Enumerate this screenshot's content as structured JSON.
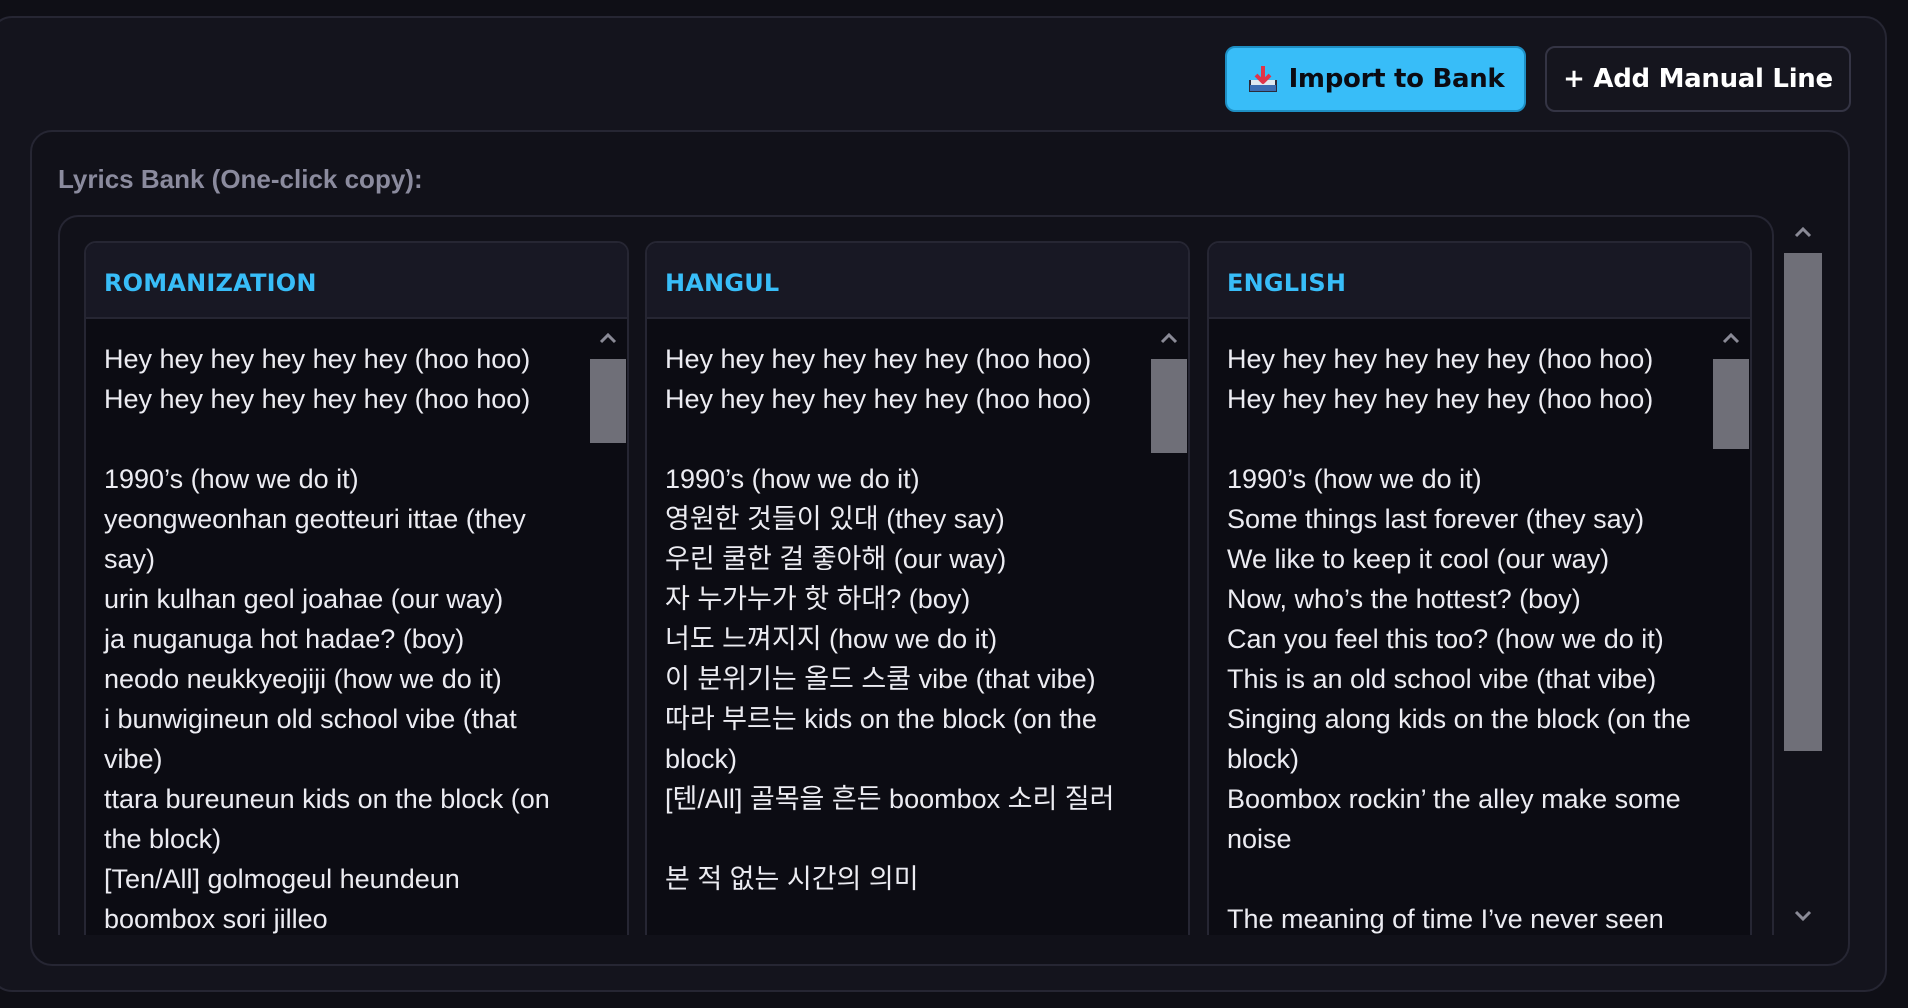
{
  "toolbar": {
    "import_label": "Import to Bank",
    "import_icon": "inbox-download-icon",
    "add_label": "+ Add Manual Line"
  },
  "bank": {
    "label": "Lyrics Bank (One-click copy):"
  },
  "columns": [
    {
      "title": "ROMANIZATION",
      "lines": [
        "Hey hey hey hey hey hey (hoo hoo)",
        "Hey hey hey hey hey hey (hoo hoo)",
        "",
        "1990’s (how we do it)",
        "yeongweonhan geotteuri ittae (they say)",
        "urin kulhan geol joahae (our way)",
        "ja nuganuga hot hadae? (boy)",
        "neodo neukkyeojiji (how we do it)",
        "i bunwigineun old school vibe (that vibe)",
        "ttara bureuneun kids on the block (on the block)",
        "[Ten/All] golmogeul heundeun boombox sori jilleo"
      ]
    },
    {
      "title": "HANGUL",
      "lines": [
        "Hey hey hey hey hey hey (hoo hoo)",
        "Hey hey hey hey hey hey (hoo hoo)",
        "",
        "1990’s (how we do it)",
        "영원한 것들이 있대 (they say)",
        "우린 쿨한 걸 좋아해 (our way)",
        "자 누가누가 핫 하대? (boy)",
        "너도 느껴지지 (how we do it)",
        "이 분위기는 올드 스쿨 vibe (that vibe)",
        "따라 부르는 kids on the block (on the block)",
        "[텐/All] 골목을 흔든 boombox 소리 질러",
        "",
        "본 적 없는 시간의 의미"
      ]
    },
    {
      "title": "ENGLISH",
      "lines": [
        "Hey hey hey hey hey hey (hoo hoo)",
        "Hey hey hey hey hey hey (hoo hoo)",
        "",
        "1990’s (how we do it)",
        "Some things last forever (they say)",
        "We like to keep it cool (our way)",
        "Now, who’s the hottest? (boy)",
        "Can you feel this too? (how we do it)",
        "This is an old school vibe (that vibe)",
        "Singing along kids on the block (on the block)",
        "Boombox rockin’ the alley make some noise",
        "",
        "The meaning of time I’ve never seen"
      ]
    }
  ],
  "colors": {
    "accent": "#38bdf8",
    "background": "#0f0f16",
    "panel": "#14141d",
    "scroll_thumb": "#6f6f78"
  }
}
